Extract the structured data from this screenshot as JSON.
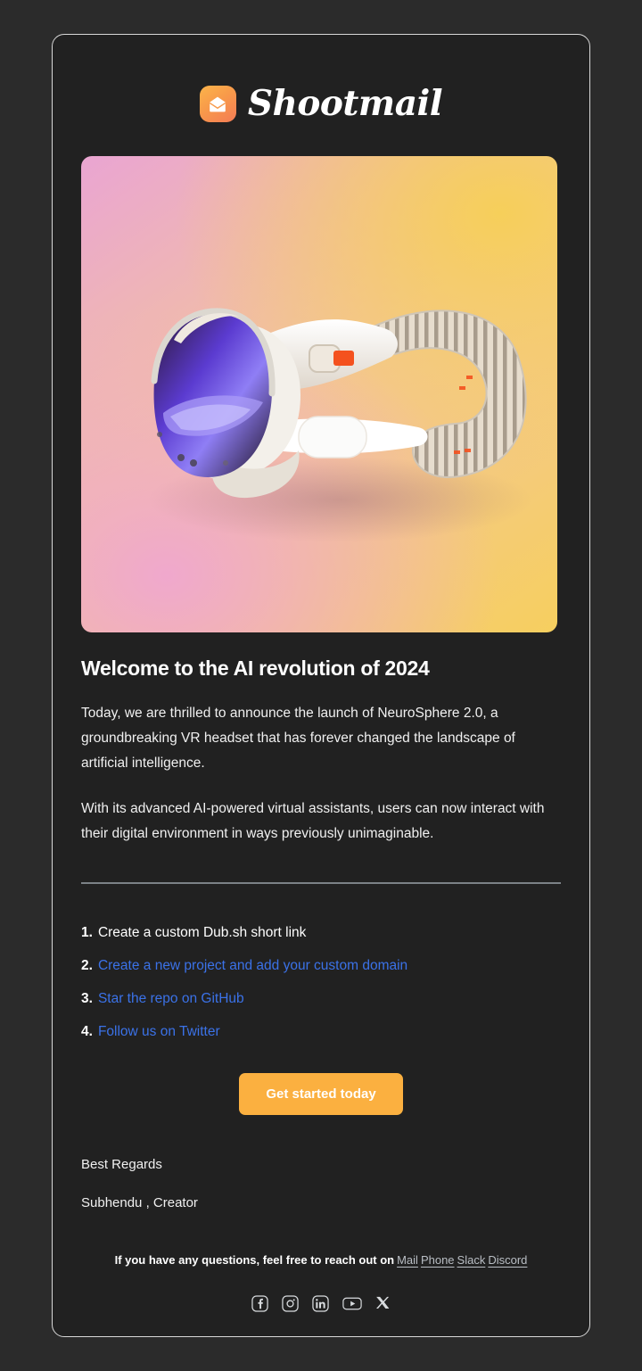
{
  "brand": {
    "name": "Shootmail",
    "mark_icon": "envelope-icon",
    "mark_gradient_from": "#fcb44a",
    "mark_gradient_to": "#f47b55"
  },
  "hero": {
    "alt": "White VR headset on pink and yellow gradient background",
    "bg_gradient_from": "#eaa5d2",
    "bg_gradient_to": "#f6cf5f"
  },
  "content": {
    "headline": "Welcome to the AI revolution of 2024",
    "paragraphs": [
      "Today, we are thrilled to announce the launch of NeuroSphere 2.0, a groundbreaking VR headset that has forever changed the landscape of artificial intelligence.",
      "With its advanced AI-powered virtual assistants, users can now interact with their digital environment in ways previously unimaginable."
    ],
    "steps": [
      {
        "num": "1.",
        "text": "Create a custom Dub.sh short link",
        "is_link": false
      },
      {
        "num": "2.",
        "text": "Create a new project and add your custom domain",
        "is_link": true
      },
      {
        "num": "3.",
        "text": "Star the repo on GitHub",
        "is_link": true
      },
      {
        "num": "4.",
        "text": "Follow us on Twitter",
        "is_link": true
      }
    ],
    "link_color": "#3b72e8",
    "cta_label": "Get started today",
    "cta_color": "#fbb040",
    "signoff_line1": "Best Regards",
    "signoff_line2": "Subhendu , Creator"
  },
  "footer": {
    "text": "If you have any questions, feel free to reach out on",
    "links": [
      "Mail",
      "Phone",
      "Slack",
      "Discord"
    ],
    "socials": [
      {
        "name": "facebook-icon",
        "label": "Facebook"
      },
      {
        "name": "instagram-icon",
        "label": "Instagram"
      },
      {
        "name": "linkedin-icon",
        "label": "LinkedIn"
      },
      {
        "name": "youtube-icon",
        "label": "YouTube"
      },
      {
        "name": "x-twitter-icon",
        "label": "X"
      }
    ]
  }
}
